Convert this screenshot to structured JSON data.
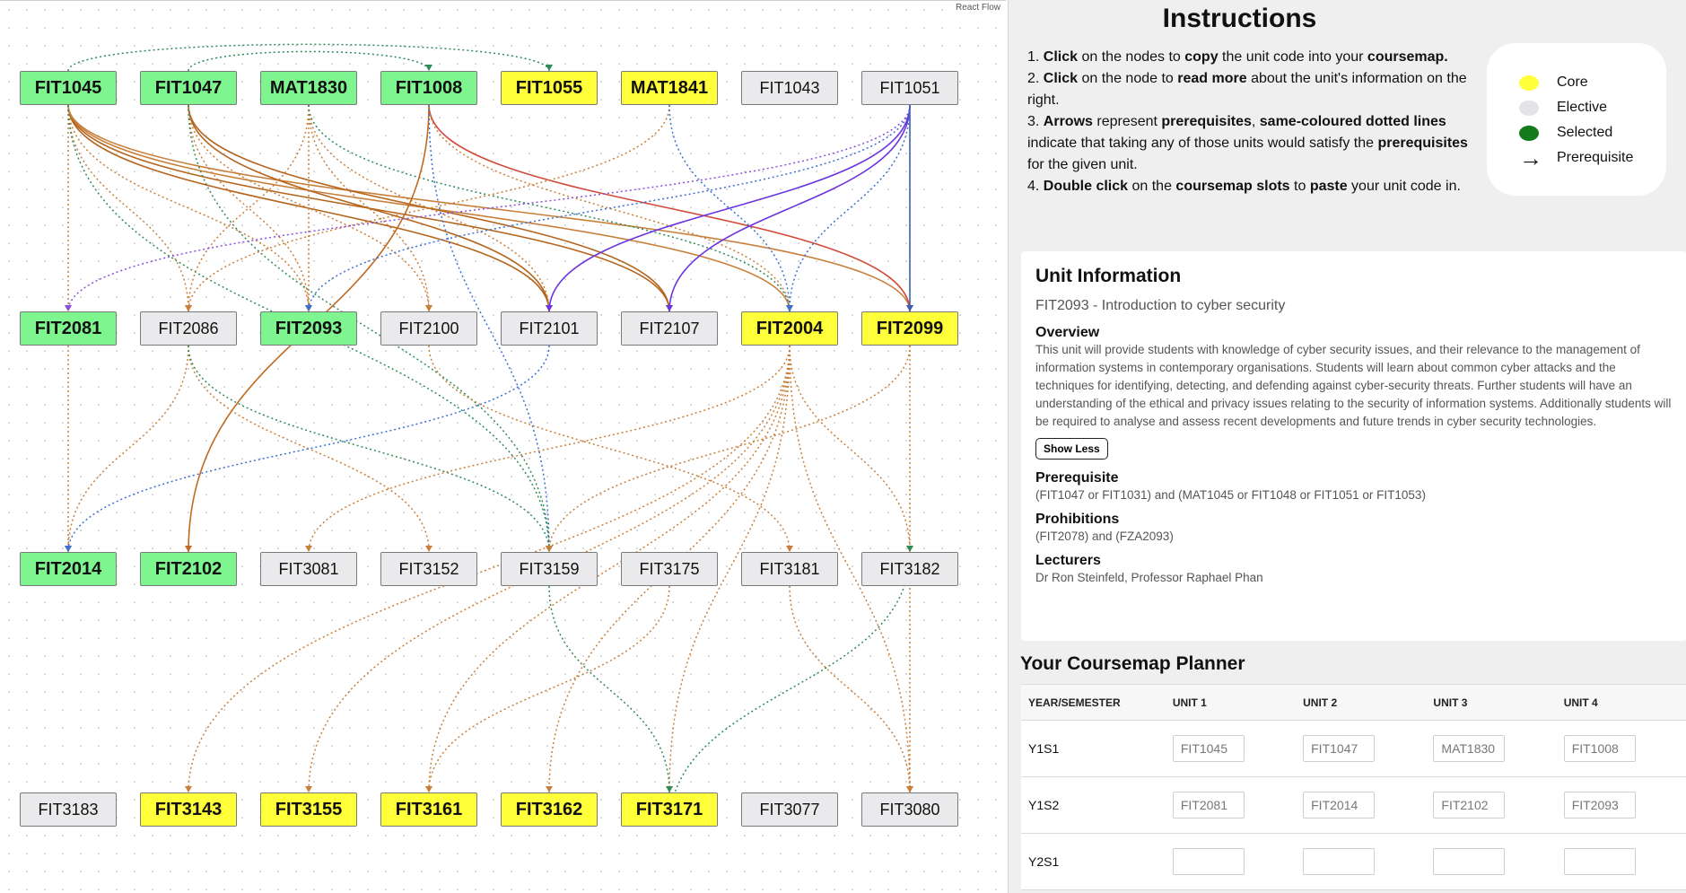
{
  "flow": {
    "watermark": "React Flow",
    "nodes": [
      {
        "id": "FIT1045",
        "type": "selected"
      },
      {
        "id": "FIT1047",
        "type": "selected"
      },
      {
        "id": "MAT1830",
        "type": "selected"
      },
      {
        "id": "FIT1008",
        "type": "selected"
      },
      {
        "id": "FIT1055",
        "type": "core"
      },
      {
        "id": "MAT1841",
        "type": "core"
      },
      {
        "id": "FIT1043",
        "type": "elective"
      },
      {
        "id": "FIT1051",
        "type": "elective"
      },
      {
        "id": "FIT2081",
        "type": "selected"
      },
      {
        "id": "FIT2086",
        "type": "elective"
      },
      {
        "id": "FIT2093",
        "type": "selected"
      },
      {
        "id": "FIT2100",
        "type": "elective"
      },
      {
        "id": "FIT2101",
        "type": "elective"
      },
      {
        "id": "FIT2107",
        "type": "elective"
      },
      {
        "id": "FIT2004",
        "type": "core"
      },
      {
        "id": "FIT2099",
        "type": "core"
      },
      {
        "id": "FIT2014",
        "type": "selected"
      },
      {
        "id": "FIT2102",
        "type": "selected"
      },
      {
        "id": "FIT3081",
        "type": "elective"
      },
      {
        "id": "FIT3152",
        "type": "elective"
      },
      {
        "id": "FIT3159",
        "type": "elective"
      },
      {
        "id": "FIT3175",
        "type": "elective"
      },
      {
        "id": "FIT3181",
        "type": "elective"
      },
      {
        "id": "FIT3182",
        "type": "elective"
      },
      {
        "id": "FIT3183",
        "type": "elective"
      },
      {
        "id": "FIT3143",
        "type": "core"
      },
      {
        "id": "FIT3155",
        "type": "core"
      },
      {
        "id": "FIT3161",
        "type": "core"
      },
      {
        "id": "FIT3162",
        "type": "core"
      },
      {
        "id": "FIT3171",
        "type": "core"
      },
      {
        "id": "FIT3077",
        "type": "elective"
      },
      {
        "id": "FIT3080",
        "type": "elective"
      }
    ],
    "edges": [
      {
        "from": "FIT1045",
        "to": "FIT2081",
        "color": "#c87f3a",
        "style": "dotted"
      },
      {
        "from": "FIT1045",
        "to": "FIT2086",
        "color": "#c87f3a",
        "style": "dotted"
      },
      {
        "from": "FIT1045",
        "to": "FIT2093",
        "color": "#c87f3a",
        "style": "dotted"
      },
      {
        "from": "FIT1045",
        "to": "FIT2101",
        "color": "#b5651d",
        "style": "solid"
      },
      {
        "from": "FIT1045",
        "to": "FIT2107",
        "color": "#b5651d",
        "style": "solid"
      },
      {
        "from": "FIT1045",
        "to": "FIT2099",
        "color": "#c87f3a",
        "style": "solid"
      },
      {
        "from": "FIT1045",
        "to": "FIT2004",
        "color": "#c87f3a",
        "style": "solid"
      },
      {
        "from": "FIT1045",
        "to": "FIT3159",
        "color": "#2e8b57",
        "style": "dotted"
      },
      {
        "from": "FIT1047",
        "to": "FIT2093",
        "color": "#c87f3a",
        "style": "dotted"
      },
      {
        "from": "FIT1047",
        "to": "FIT2101",
        "color": "#b5651d",
        "style": "solid"
      },
      {
        "from": "FIT1047",
        "to": "FIT2107",
        "color": "#b5651d",
        "style": "solid"
      },
      {
        "from": "FIT1047",
        "to": "FIT2100",
        "color": "#c87f3a",
        "style": "dotted"
      },
      {
        "from": "FIT1047",
        "to": "FIT3159",
        "color": "#2e8b57",
        "style": "dotted"
      },
      {
        "from": "FIT1047",
        "to": "FIT1008",
        "color": "#2e8b57",
        "style": "dotted"
      },
      {
        "from": "FIT1045",
        "to": "FIT1055",
        "color": "#2e8b57",
        "style": "dotted"
      },
      {
        "from": "MAT1830",
        "to": "FIT2086",
        "color": "#c87f3a",
        "style": "dotted"
      },
      {
        "from": "MAT1830",
        "to": "FIT2093",
        "color": "#c87f3a",
        "style": "dotted"
      },
      {
        "from": "MAT1830",
        "to": "FIT2100",
        "color": "#c87f3a",
        "style": "dotted"
      },
      {
        "from": "MAT1830",
        "to": "FIT2101",
        "color": "#c87f3a",
        "style": "dotted"
      },
      {
        "from": "MAT1830",
        "to": "FIT2004",
        "color": "#2e8b57",
        "style": "dotted"
      },
      {
        "from": "FIT1008",
        "to": "FIT2099",
        "color": "#d24a3a",
        "style": "solid"
      },
      {
        "from": "FIT1008",
        "to": "FIT2102",
        "color": "#c06a20",
        "style": "solid"
      },
      {
        "from": "FIT1008",
        "to": "FIT2004",
        "color": "#c87f3a",
        "style": "dotted"
      },
      {
        "from": "FIT1008",
        "to": "FIT3159",
        "color": "#3b6fd4",
        "style": "dotted"
      },
      {
        "from": "MAT1841",
        "to": "FIT2086",
        "color": "#c87f3a",
        "style": "dotted"
      },
      {
        "from": "MAT1841",
        "to": "FIT2004",
        "color": "#3b6fd4",
        "style": "dotted"
      },
      {
        "from": "FIT1051",
        "to": "FIT2081",
        "color": "#8a4fe0",
        "style": "dotted"
      },
      {
        "from": "FIT1051",
        "to": "FIT2093",
        "color": "#3b6fd4",
        "style": "dotted"
      },
      {
        "from": "FIT1051",
        "to": "FIT2101",
        "color": "#6a35e0",
        "style": "solid"
      },
      {
        "from": "FIT1051",
        "to": "FIT2107",
        "color": "#6a35e0",
        "style": "solid"
      },
      {
        "from": "FIT1051",
        "to": "FIT2099",
        "color": "#3b5fb0",
        "style": "solid"
      },
      {
        "from": "FIT1051",
        "to": "FIT2004",
        "color": "#3b6fd4",
        "style": "dotted"
      },
      {
        "from": "FIT2081",
        "to": "FIT2014",
        "color": "#c87f3a",
        "style": "dotted"
      },
      {
        "from": "FIT2086",
        "to": "FIT2014",
        "color": "#c87f3a",
        "style": "dotted"
      },
      {
        "from": "FIT2086",
        "to": "FIT3152",
        "color": "#c87f3a",
        "style": "dotted"
      },
      {
        "from": "FIT2086",
        "to": "FIT3159",
        "color": "#2e8b57",
        "style": "dotted"
      },
      {
        "from": "FIT2101",
        "to": "FIT2014",
        "color": "#3b6fd4",
        "style": "dotted"
      },
      {
        "from": "FIT2100",
        "to": "FIT3181",
        "color": "#c87f3a",
        "style": "dotted"
      },
      {
        "from": "FIT2004",
        "to": "FIT3081",
        "color": "#c87f3a",
        "style": "dotted"
      },
      {
        "from": "FIT2004",
        "to": "FIT3182",
        "color": "#c87f3a",
        "style": "dotted"
      },
      {
        "from": "FIT2004",
        "to": "FIT3143",
        "color": "#c87f3a",
        "style": "dotted"
      },
      {
        "from": "FIT2004",
        "to": "FIT3155",
        "color": "#c87f3a",
        "style": "dotted"
      },
      {
        "from": "FIT2004",
        "to": "FIT3161",
        "color": "#c87f3a",
        "style": "dotted"
      },
      {
        "from": "FIT2004",
        "to": "FIT3162",
        "color": "#c87f3a",
        "style": "dotted"
      },
      {
        "from": "FIT2004",
        "to": "FIT3171",
        "color": "#c87f3a",
        "style": "dotted"
      },
      {
        "from": "FIT2004",
        "to": "FIT3080",
        "color": "#c87f3a",
        "style": "dotted"
      },
      {
        "from": "FIT2099",
        "to": "FIT3159",
        "color": "#c87f3a",
        "style": "dotted"
      },
      {
        "from": "FIT2099",
        "to": "FIT3080",
        "color": "#c87f3a",
        "style": "dotted"
      },
      {
        "from": "FIT3159",
        "to": "FIT3171",
        "color": "#2e8b57",
        "style": "dotted"
      },
      {
        "from": "FIT3171",
        "to": "FIT3182",
        "color": "#2e8b57",
        "style": "dotted"
      },
      {
        "from": "FIT3181",
        "to": "FIT3080",
        "color": "#c87f3a",
        "style": "dotted"
      },
      {
        "from": "FIT3175",
        "to": "FIT3161",
        "color": "#c87f3a",
        "style": "dotted"
      }
    ]
  },
  "instructions": {
    "title": "Instructions",
    "steps": [
      [
        {
          "b": "1. "
        },
        {
          "s": "Click",
          "bold": true
        },
        {
          "t": " on the nodes to "
        },
        {
          "s": "copy",
          "bold": true
        },
        {
          "t": " the unit code into your "
        },
        {
          "s": "coursemap.",
          "bold": true
        }
      ],
      [
        {
          "b": "2. "
        },
        {
          "s": "Click",
          "bold": true
        },
        {
          "t": " on the node to "
        },
        {
          "s": "read more",
          "bold": true
        },
        {
          "t": " about the unit's information on the right."
        }
      ],
      [
        {
          "b": "3. "
        },
        {
          "s": "Arrows",
          "bold": true
        },
        {
          "t": " represent "
        },
        {
          "s": "prerequisites",
          "bold": true
        },
        {
          "t": ", "
        },
        {
          "s": "same-coloured dotted lines",
          "bold": true
        },
        {
          "t": " indicate that taking any of those units would satisfy the "
        },
        {
          "s": "prerequisites",
          "bold": true
        },
        {
          "t": " for the given unit."
        }
      ],
      [
        {
          "b": "4. "
        },
        {
          "s": "Double click",
          "bold": true
        },
        {
          "t": " on the "
        },
        {
          "s": "coursemap slots",
          "bold": true
        },
        {
          "t": " to "
        },
        {
          "s": "paste",
          "bold": true
        },
        {
          "t": " your unit code in."
        }
      ]
    ]
  },
  "legend": {
    "items": [
      {
        "label": "Core",
        "color": "#ffff3a"
      },
      {
        "label": "Elective",
        "color": "#e4e4e6"
      },
      {
        "label": "Selected",
        "color": "#137a1e"
      },
      {
        "label": "Prerequisite",
        "arrow": "→"
      }
    ]
  },
  "unit_info": {
    "heading": "Unit Information",
    "unit_title": "FIT2093 - Introduction to cyber security",
    "overview_label": "Overview",
    "overview_text": "This unit will provide students with knowledge of cyber security issues, and their relevance to the management of information systems in contemporary organisations. Students will learn about common cyber attacks and the techniques for identifying, detecting, and defending against cyber-security threats. Further students will have an understanding of the ethical and privacy issues relating to the security of information systems. Additionally students will be required to analyse and assess recent developments and future trends in cyber security technologies.",
    "show_less": "Show Less",
    "prerequisite_label": "Prerequisite",
    "prerequisite_text": "(FIT1047 or FIT1031) and (MAT1045 or FIT1048 or FIT1051 or FIT1053)",
    "prohibitions_label": "Prohibitions",
    "prohibitions_text": "(FIT2078) and (FZA2093)",
    "lecturers_label": "Lecturers",
    "lecturers_text": "Dr Ron Steinfeld, Professor Raphael Phan"
  },
  "planner": {
    "title": "Your Coursemap Planner",
    "columns": [
      "YEAR/SEMESTER",
      "UNIT 1",
      "UNIT 2",
      "UNIT 3",
      "UNIT 4"
    ],
    "rows": [
      {
        "semester": "Y1S1",
        "slots": [
          "FIT1045",
          "FIT1047",
          "MAT1830",
          "FIT1008"
        ]
      },
      {
        "semester": "Y1S2",
        "slots": [
          "FIT2081",
          "FIT2014",
          "FIT2102",
          "FIT2093"
        ]
      },
      {
        "semester": "Y2S1",
        "slots": [
          "",
          "",
          "",
          ""
        ]
      }
    ]
  }
}
